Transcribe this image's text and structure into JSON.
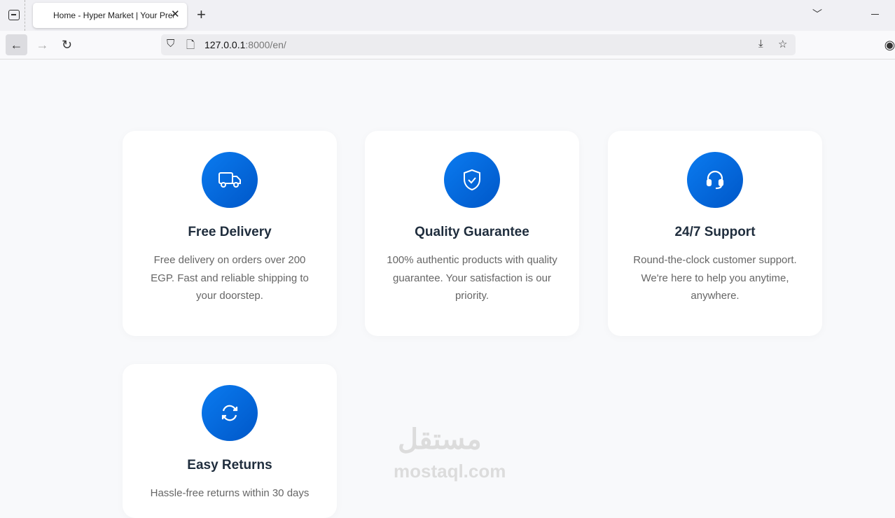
{
  "browser": {
    "tab_title": "Home - Hyper Market | Your Premium Store",
    "url_host": "127.0.0.1",
    "url_rest": ":8000/en/"
  },
  "features": [
    {
      "title": "Free Delivery",
      "text": "Free delivery on orders over 200 EGP. Fast and reliable shipping to your doorstep.",
      "icon": "truck-icon"
    },
    {
      "title": "Quality Guarantee",
      "text": "100% authentic products with quality guarantee. Your satisfaction is our priority.",
      "icon": "shield-check-icon"
    },
    {
      "title": "24/7 Support",
      "text": "Round-the-clock customer support. We're here to help you anytime, anywhere.",
      "icon": "headset-icon"
    },
    {
      "title": "Easy Returns",
      "text": "Hassle-free returns within 30 days",
      "icon": "refresh-icon"
    }
  ],
  "watermark": {
    "arabic": "مستقل",
    "latin": "mostaql.com"
  }
}
